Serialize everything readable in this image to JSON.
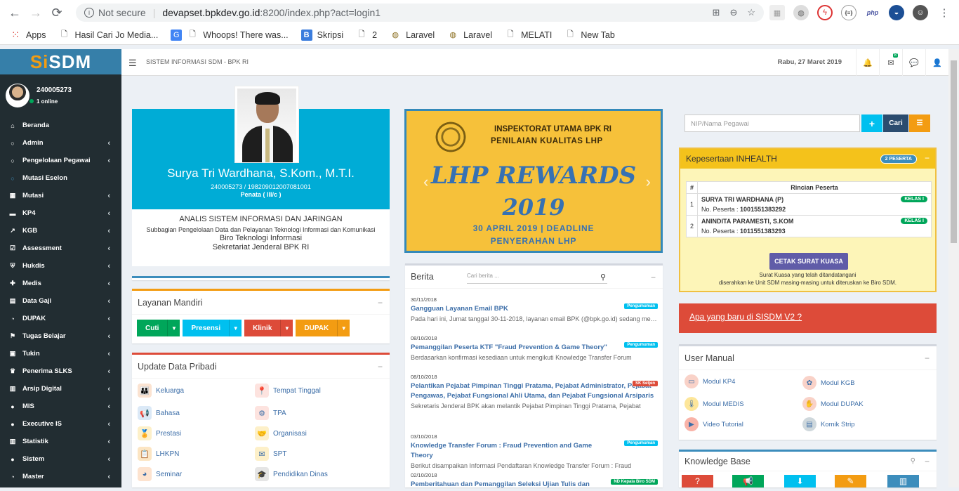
{
  "browser": {
    "nav": {
      "back": "←",
      "forward": "→",
      "reload": "⟳"
    },
    "security": "Not secure",
    "url_host": "devapset.bpkdev.go.id",
    "url_rest": ":8200/index.php?act=login1",
    "bookmarks": [
      "Apps",
      "Hasil Cari Jo Media...",
      "Whoops! There was...",
      "Skripsi",
      "2",
      "Laravel",
      "Laravel",
      "MELATI",
      "New Tab"
    ]
  },
  "sidebar": {
    "logo_s": "S",
    "logo_i": "i",
    "logo_rest": "SDM",
    "user_id": "240005273",
    "online": "1 online",
    "items": [
      {
        "icon": "home-icon",
        "glyph": "⌂",
        "label": "Beranda",
        "arrow": false
      },
      {
        "icon": "circle-icon",
        "glyph": "○",
        "label": "Admin",
        "arrow": true
      },
      {
        "icon": "circle-icon",
        "glyph": "○",
        "label": "Pengelolaan Pegawai",
        "arrow": true
      },
      {
        "icon": "circle-blue-icon",
        "glyph": "○",
        "label": "Mutasi Eselon",
        "arrow": false
      },
      {
        "icon": "grid-icon",
        "glyph": "▦",
        "label": "Mutasi",
        "arrow": true
      },
      {
        "icon": "card-icon",
        "glyph": "▬",
        "label": "KP4",
        "arrow": true
      },
      {
        "icon": "chart-icon",
        "glyph": "↗",
        "label": "KGB",
        "arrow": true
      },
      {
        "icon": "check-icon",
        "glyph": "☑",
        "label": "Assessment",
        "arrow": true
      },
      {
        "icon": "shield-icon",
        "glyph": "⛨",
        "label": "Hukdis",
        "arrow": true
      },
      {
        "icon": "medkit-icon",
        "glyph": "✚",
        "label": "Medis",
        "arrow": true
      },
      {
        "icon": "file-icon",
        "glyph": "▤",
        "label": "Data Gaji",
        "arrow": true
      },
      {
        "icon": "dashboard-icon",
        "glyph": "◔",
        "label": "DUPAK",
        "arrow": true
      },
      {
        "icon": "graduation-icon",
        "glyph": "⚑",
        "label": "Tugas Belajar",
        "arrow": true
      },
      {
        "icon": "money-icon",
        "glyph": "▣",
        "label": "Tukin",
        "arrow": true
      },
      {
        "icon": "trophy-icon",
        "glyph": "♛",
        "label": "Penerima SLKS",
        "arrow": true
      },
      {
        "icon": "archive-icon",
        "glyph": "▥",
        "label": "Arsip Digital",
        "arrow": true
      },
      {
        "icon": "globe-icon",
        "glyph": "●",
        "label": "MIS",
        "arrow": true
      },
      {
        "icon": "globe-icon",
        "glyph": "●",
        "label": "Executive IS",
        "arrow": true
      },
      {
        "icon": "bars-icon",
        "glyph": "▥",
        "label": "Statistik",
        "arrow": true
      },
      {
        "icon": "globe-icon",
        "glyph": "●",
        "label": "Sistem",
        "arrow": true
      },
      {
        "icon": "dashboard-icon",
        "glyph": "◔",
        "label": "Master",
        "arrow": true
      }
    ]
  },
  "header": {
    "title": "SISTEM INFORMASI SDM - BPK RI",
    "date": "Rabu, 27 Maret 2019",
    "mail_badge": "8",
    "burger": "☰",
    "bell": "🔔",
    "mail": "✉",
    "chat": "💬",
    "user": "👤"
  },
  "profile": {
    "name": "Surya Tri Wardhana, S.Kom., M.T.I.",
    "nip": "240005273 / 198209012007081001",
    "rank": "Penata ( III/c )",
    "jabatan": "ANALIS SISTEM INFORMASI DAN JARINGAN",
    "subbag": "Subbagian Pengelolaan Data dan Pelayanan Teknologi Informasi dan Komunikasi",
    "biro": "Biro Teknologi Informasi",
    "setjen": "Sekretariat Jenderal BPK RI"
  },
  "layanan": {
    "title": "Layanan Mandiri",
    "buttons": [
      {
        "label": "Cuti",
        "color": "#00a65a"
      },
      {
        "label": "Presensi",
        "color": "#00c0ef"
      },
      {
        "label": "Klinik",
        "color": "#dd4b39"
      },
      {
        "label": "DUPAK",
        "color": "#f39c12"
      }
    ]
  },
  "update": {
    "title": "Update Data Pribadi",
    "left": [
      {
        "label": "Keluarga",
        "icon": "family-icon",
        "glyph": "👪",
        "bg": "#fbe3d1"
      },
      {
        "label": "Bahasa",
        "icon": "megaphone-icon",
        "glyph": "📢",
        "bg": "#dbe9f7"
      },
      {
        "label": "Prestasi",
        "icon": "medal-icon",
        "glyph": "🏅",
        "bg": "#fdf0c9"
      },
      {
        "label": "LHKPN",
        "icon": "clipboard-icon",
        "glyph": "📋",
        "bg": "#fce5c3"
      },
      {
        "label": "Seminar",
        "icon": "pie-icon",
        "glyph": "◕",
        "bg": "#fde3cf"
      }
    ],
    "right": [
      {
        "label": "Tempat Tinggal",
        "icon": "location-icon",
        "glyph": "📍",
        "bg": "#fde3df"
      },
      {
        "label": "TPA",
        "icon": "gears-icon",
        "glyph": "⚙",
        "bg": "#fde3df"
      },
      {
        "label": "Organisasi",
        "icon": "handshake-icon",
        "glyph": "🤝",
        "bg": "#fdf0c9"
      },
      {
        "label": "SPT",
        "icon": "envelope-icon",
        "glyph": "✉",
        "bg": "#fdf0c9"
      },
      {
        "label": "Pendidikan Dinas",
        "icon": "graduation-cap-icon",
        "glyph": "🎓",
        "bg": "#e5e5e5"
      }
    ]
  },
  "banner": {
    "line1": "INSPEKTORAT UTAMA BPK RI",
    "line2": "PENILAIAN KUALITAS LHP",
    "big1": "LHP REWARDS",
    "big2": "2019",
    "deadline1": "30 APRIL 2019 | DEADLINE",
    "deadline2": "PENYERAHAN LHP",
    "prev": "‹",
    "next": "›"
  },
  "berita": {
    "title": "Berita",
    "search_placeholder": "Cari berita ...",
    "items": [
      {
        "date": "30/11/2018",
        "title": "Gangguan Layanan Email BPK",
        "badge": "Pengumuman",
        "badge_color": "#00c0ef",
        "snippet": "Pada hari ini, Jumat tanggal 30-11-2018, layanan email BPK (@bpk.go.id) sedang mengalami gangguan"
      },
      {
        "date": "08/10/2018",
        "title": "Pemanggilan Peserta KTF \"Fraud Prevention & Game Theory\"",
        "badge": "Pengumuman",
        "badge_color": "#00c0ef",
        "snippet": "Berdasarkan konfirmasi kesediaan untuk mengikuti Knowledge Transfer Forum"
      },
      {
        "date": "08/10/2018",
        "title": "Pelantikan Pejabat Pimpinan Tinggi Pratama, Pejabat Administrator, Pejabat Pengawas, Pejabat Fungsional Ahli Utama, dan Pejabat Fungsional Arsiparis",
        "badge": "SK Setjen",
        "badge_color": "#dd4b39",
        "snippet": "Sekretaris Jenderal BPK akan melantik Pejabat Pimpinan Tinggi Pratama, Pejabat"
      },
      {
        "date": "03/10/2018",
        "title": "Knowledge Transfer Forum : Fraud Prevention and Game Theory",
        "badge": "Pengumuman",
        "badge_color": "#00c0ef",
        "snippet": "Berikut disampaikan Informasi Pendaftaran Knowledge Transfer Forum : Fraud"
      },
      {
        "date": "02/10/2018",
        "title": "Pemberitahuan dan Pemanggilan Seleksi Ujian Tulis dan",
        "badge": "ND Kepala Biro SDM",
        "badge_color": "#00a65a",
        "snippet": ""
      }
    ]
  },
  "search": {
    "placeholder": "NIP/Nama Pegawai",
    "plus": "+",
    "cari": "Cari",
    "list": "☰"
  },
  "inhealth": {
    "title": "Kepesertaan INHEALTH",
    "pill": "2 PESERTA",
    "col_no": "#",
    "col_detail": "Rincian Peserta",
    "rows": [
      {
        "no": "1",
        "name": "SURYA TRI WARDHANA (P)",
        "peserta_label": "No. Peserta : ",
        "peserta": "1001551383292",
        "kelas": "KELAS I"
      },
      {
        "no": "2",
        "name": "ANINDITA PARAMESTI, S.KOM",
        "peserta_label": "No. Peserta : ",
        "peserta": "1011551383293",
        "kelas": "KELAS I"
      }
    ],
    "button": "CETAK SURAT KUASA",
    "note1": "Surat Kuasa yang telah ditandatangani",
    "note2": "diserahkan ke Unit SDM masing-masing untuk diteruskan ke Biro SDM."
  },
  "whatsnew": "Apa yang baru di SISDM V2 ?",
  "manual": {
    "title": "User Manual",
    "items": [
      {
        "label": "Modul KP4",
        "icon": "id-card-icon",
        "glyph": "▭",
        "bg": "#f9d2c8"
      },
      {
        "label": "Modul KGB",
        "icon": "puzzle-icon",
        "glyph": "✿",
        "bg": "#f9d2c8"
      },
      {
        "label": "Modul MEDIS",
        "icon": "thermometer-icon",
        "glyph": "🌡",
        "bg": "#fde69a"
      },
      {
        "label": "Modul DUPAK",
        "icon": "hand-icon",
        "glyph": "✋",
        "bg": "#f9d2c8"
      },
      {
        "label": "Video Tutorial",
        "icon": "video-icon",
        "glyph": "▶",
        "bg": "#f9b3a8"
      },
      {
        "label": "Komik Strip",
        "icon": "comic-icon",
        "glyph": "▤",
        "bg": "#cfd8dc"
      }
    ]
  },
  "kb": {
    "title": "Knowledge Base",
    "search": "🔍",
    "minus": "−",
    "buttons": [
      {
        "glyph": "?",
        "color": "#dd4b39",
        "icon": "question-icon"
      },
      {
        "glyph": "📢",
        "color": "#00a65a",
        "icon": "megaphone-icon"
      },
      {
        "glyph": "⬇",
        "color": "#00c0ef",
        "icon": "download-icon"
      },
      {
        "glyph": "✎",
        "color": "#f39c12",
        "icon": "ticket-icon"
      },
      {
        "glyph": "▥",
        "color": "#3c8dbc",
        "icon": "book-icon"
      }
    ]
  }
}
